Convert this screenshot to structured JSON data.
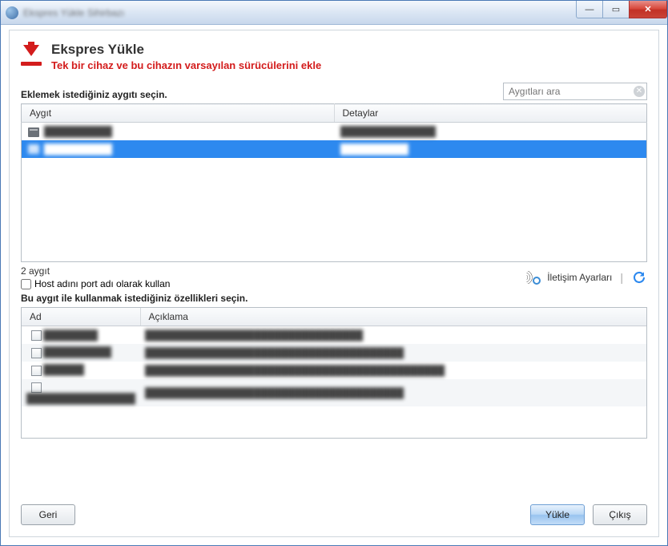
{
  "window": {
    "title": "Ekspres Yükle Sihirbazı"
  },
  "header": {
    "title": "Ekspres Yükle",
    "subtitle": "Tek bir cihaz ve bu cihazın varsayılan sürücülerini ekle"
  },
  "search": {
    "placeholder": "Aygıtları ara"
  },
  "section_device_label": "Eklemek istediğiniz aygıtı seçin.",
  "device_columns": {
    "name": "Aygıt",
    "details": "Detaylar"
  },
  "devices": [
    {
      "name": "██████████",
      "details": "██████████████",
      "selected": false
    },
    {
      "name": "██████████",
      "details": "██████████",
      "selected": true
    }
  ],
  "device_count_label": "2 aygıt",
  "hostport_checkbox_label": "Host adını port adı olarak kullan",
  "comm_settings_label": "İletişim Ayarları",
  "section_features_label": "Bu aygıt ile kullanmak istediğiniz özellikleri seçin.",
  "feature_columns": {
    "name": "Ad",
    "desc": "Açıklama"
  },
  "features": [
    {
      "name": "████████",
      "desc": "████████████████████████████████"
    },
    {
      "name": "██████████",
      "desc": "██████████████████████████████████████"
    },
    {
      "name": "██████",
      "desc": "████████████████████████████████████████████"
    },
    {
      "name": "████████████████",
      "desc": "██████████████████████████████████████"
    }
  ],
  "buttons": {
    "back": "Geri",
    "install": "Yükle",
    "exit": "Çıkış"
  }
}
